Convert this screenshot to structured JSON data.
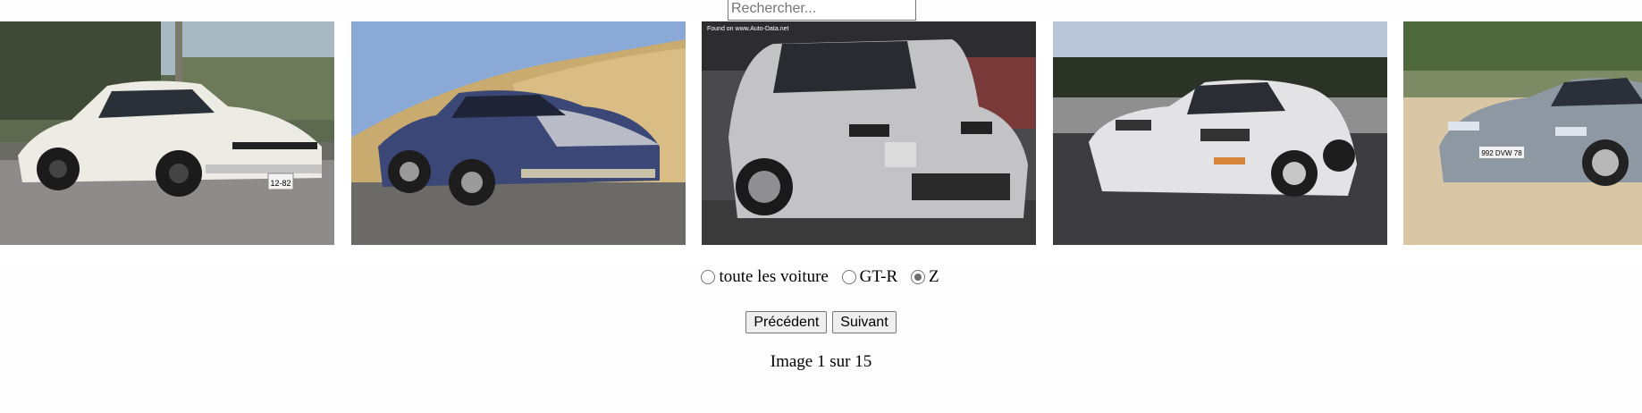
{
  "search": {
    "placeholder": "Rechercher...",
    "value": ""
  },
  "gallery": {
    "images": [
      {
        "icon": "white-nissan-240z-photo"
      },
      {
        "icon": "blue-silver-datsun-280zx-photo"
      },
      {
        "icon": "silver-nissan-300zx-z31-photo",
        "caption": "Found on www.Auto-Data.net"
      },
      {
        "icon": "white-nissan-300zx-z32-photo"
      },
      {
        "icon": "grey-nissan-350z-photo",
        "plate": "992 DVW 78"
      }
    ],
    "first_plate": "12-82"
  },
  "filters": {
    "options": [
      {
        "label": "toute les voiture",
        "checked": false
      },
      {
        "label": "GT-R",
        "checked": false
      },
      {
        "label": "Z",
        "checked": true
      }
    ]
  },
  "nav": {
    "prev_label": "Précédent",
    "next_label": "Suivant"
  },
  "counter": "Image 1 sur 15",
  "colors": {
    "scroll_thumb": "#8a8a8a",
    "scroll_track": "#f1f1f1",
    "radio_checked": "#6e6e6e"
  }
}
